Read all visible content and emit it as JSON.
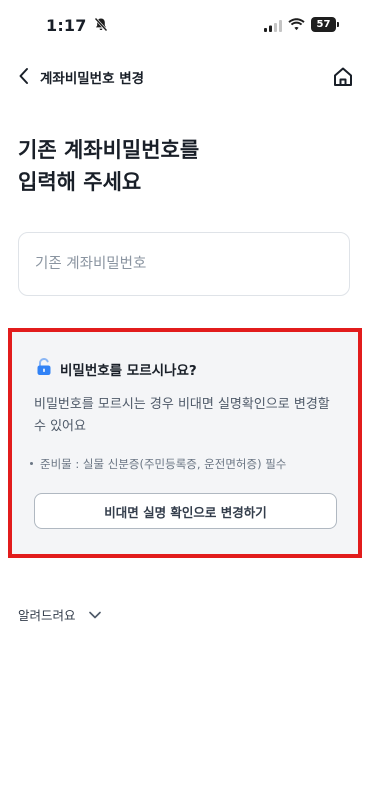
{
  "status_bar": {
    "time": "1:17",
    "battery": "57"
  },
  "nav": {
    "title": "계좌비밀번호 변경"
  },
  "headline": {
    "line1": "기존 계좌비밀번호를",
    "line2": "입력해 주세요"
  },
  "password_input": {
    "placeholder": "기존 계좌비밀번호",
    "value": ""
  },
  "help": {
    "title": "비밀번호를 모르시나요?",
    "description": "비밀번호를 모르시는 경우 비대면 실명확인으로 변경할 수 있어요",
    "note": "준비물 : 실물 신분증(주민등록증, 운전면허증) 필수",
    "button_label": "비대면 실명 확인으로 변경하기"
  },
  "notice": {
    "label": "알려드려요"
  },
  "colors": {
    "highlight_border": "#e21c1c",
    "lock_icon": "#3182f6",
    "card_background": "#f4f5f7"
  }
}
